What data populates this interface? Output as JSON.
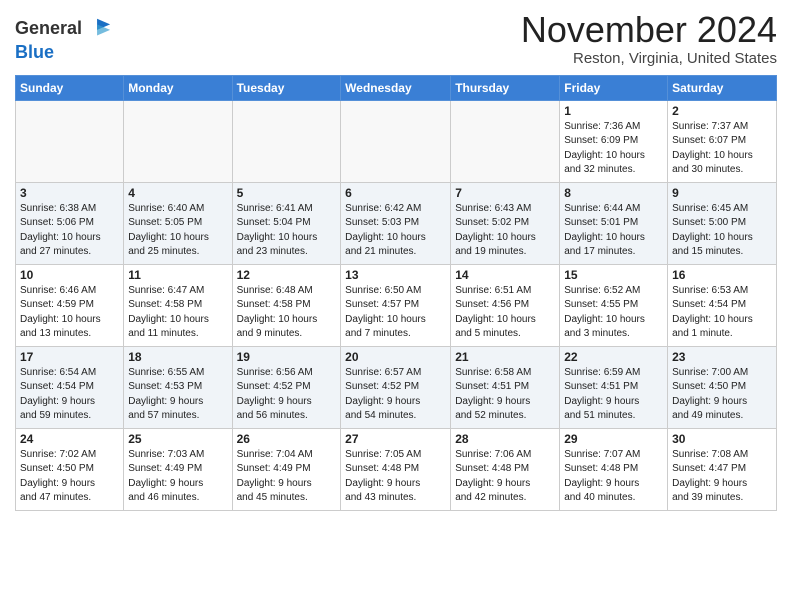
{
  "header": {
    "logo_general": "General",
    "logo_blue": "Blue",
    "month_title": "November 2024",
    "location": "Reston, Virginia, United States"
  },
  "weekdays": [
    "Sunday",
    "Monday",
    "Tuesday",
    "Wednesday",
    "Thursday",
    "Friday",
    "Saturday"
  ],
  "weeks": [
    [
      {
        "day": "",
        "info": ""
      },
      {
        "day": "",
        "info": ""
      },
      {
        "day": "",
        "info": ""
      },
      {
        "day": "",
        "info": ""
      },
      {
        "day": "",
        "info": ""
      },
      {
        "day": "1",
        "info": "Sunrise: 7:36 AM\nSunset: 6:09 PM\nDaylight: 10 hours\nand 32 minutes."
      },
      {
        "day": "2",
        "info": "Sunrise: 7:37 AM\nSunset: 6:07 PM\nDaylight: 10 hours\nand 30 minutes."
      }
    ],
    [
      {
        "day": "3",
        "info": "Sunrise: 6:38 AM\nSunset: 5:06 PM\nDaylight: 10 hours\nand 27 minutes."
      },
      {
        "day": "4",
        "info": "Sunrise: 6:40 AM\nSunset: 5:05 PM\nDaylight: 10 hours\nand 25 minutes."
      },
      {
        "day": "5",
        "info": "Sunrise: 6:41 AM\nSunset: 5:04 PM\nDaylight: 10 hours\nand 23 minutes."
      },
      {
        "day": "6",
        "info": "Sunrise: 6:42 AM\nSunset: 5:03 PM\nDaylight: 10 hours\nand 21 minutes."
      },
      {
        "day": "7",
        "info": "Sunrise: 6:43 AM\nSunset: 5:02 PM\nDaylight: 10 hours\nand 19 minutes."
      },
      {
        "day": "8",
        "info": "Sunrise: 6:44 AM\nSunset: 5:01 PM\nDaylight: 10 hours\nand 17 minutes."
      },
      {
        "day": "9",
        "info": "Sunrise: 6:45 AM\nSunset: 5:00 PM\nDaylight: 10 hours\nand 15 minutes."
      }
    ],
    [
      {
        "day": "10",
        "info": "Sunrise: 6:46 AM\nSunset: 4:59 PM\nDaylight: 10 hours\nand 13 minutes."
      },
      {
        "day": "11",
        "info": "Sunrise: 6:47 AM\nSunset: 4:58 PM\nDaylight: 10 hours\nand 11 minutes."
      },
      {
        "day": "12",
        "info": "Sunrise: 6:48 AM\nSunset: 4:58 PM\nDaylight: 10 hours\nand 9 minutes."
      },
      {
        "day": "13",
        "info": "Sunrise: 6:50 AM\nSunset: 4:57 PM\nDaylight: 10 hours\nand 7 minutes."
      },
      {
        "day": "14",
        "info": "Sunrise: 6:51 AM\nSunset: 4:56 PM\nDaylight: 10 hours\nand 5 minutes."
      },
      {
        "day": "15",
        "info": "Sunrise: 6:52 AM\nSunset: 4:55 PM\nDaylight: 10 hours\nand 3 minutes."
      },
      {
        "day": "16",
        "info": "Sunrise: 6:53 AM\nSunset: 4:54 PM\nDaylight: 10 hours\nand 1 minute."
      }
    ],
    [
      {
        "day": "17",
        "info": "Sunrise: 6:54 AM\nSunset: 4:54 PM\nDaylight: 9 hours\nand 59 minutes."
      },
      {
        "day": "18",
        "info": "Sunrise: 6:55 AM\nSunset: 4:53 PM\nDaylight: 9 hours\nand 57 minutes."
      },
      {
        "day": "19",
        "info": "Sunrise: 6:56 AM\nSunset: 4:52 PM\nDaylight: 9 hours\nand 56 minutes."
      },
      {
        "day": "20",
        "info": "Sunrise: 6:57 AM\nSunset: 4:52 PM\nDaylight: 9 hours\nand 54 minutes."
      },
      {
        "day": "21",
        "info": "Sunrise: 6:58 AM\nSunset: 4:51 PM\nDaylight: 9 hours\nand 52 minutes."
      },
      {
        "day": "22",
        "info": "Sunrise: 6:59 AM\nSunset: 4:51 PM\nDaylight: 9 hours\nand 51 minutes."
      },
      {
        "day": "23",
        "info": "Sunrise: 7:00 AM\nSunset: 4:50 PM\nDaylight: 9 hours\nand 49 minutes."
      }
    ],
    [
      {
        "day": "24",
        "info": "Sunrise: 7:02 AM\nSunset: 4:50 PM\nDaylight: 9 hours\nand 47 minutes."
      },
      {
        "day": "25",
        "info": "Sunrise: 7:03 AM\nSunset: 4:49 PM\nDaylight: 9 hours\nand 46 minutes."
      },
      {
        "day": "26",
        "info": "Sunrise: 7:04 AM\nSunset: 4:49 PM\nDaylight: 9 hours\nand 45 minutes."
      },
      {
        "day": "27",
        "info": "Sunrise: 7:05 AM\nSunset: 4:48 PM\nDaylight: 9 hours\nand 43 minutes."
      },
      {
        "day": "28",
        "info": "Sunrise: 7:06 AM\nSunset: 4:48 PM\nDaylight: 9 hours\nand 42 minutes."
      },
      {
        "day": "29",
        "info": "Sunrise: 7:07 AM\nSunset: 4:48 PM\nDaylight: 9 hours\nand 40 minutes."
      },
      {
        "day": "30",
        "info": "Sunrise: 7:08 AM\nSunset: 4:47 PM\nDaylight: 9 hours\nand 39 minutes."
      }
    ]
  ]
}
